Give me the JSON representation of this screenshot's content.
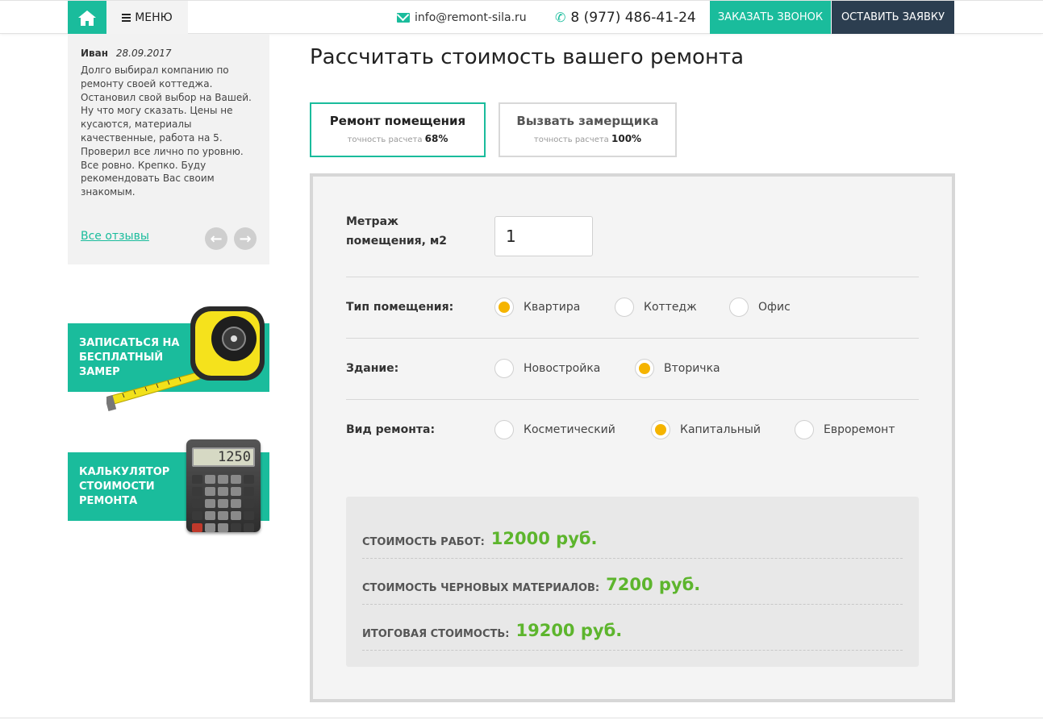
{
  "colors": {
    "accent": "#1abc9c",
    "dark": "#2c3e50",
    "price": "#5db52d",
    "radio_selected": "#f5b400"
  },
  "header": {
    "home_icon": "home-icon",
    "menu_label": "МЕНЮ",
    "email": "info@remont-sila.ru",
    "phone": "8 (977) 486-41-24",
    "call_button": "ЗАКАЗАТЬ ЗВОНОК",
    "order_button": "ОСТАВИТЬ ЗАЯВКУ"
  },
  "review": {
    "author": "Иван",
    "date": "28.09.2017",
    "text": "Долго выбирал компанию по ремонту своей коттеджа. Остановил свой выбор на Вашей. Ну что могу сказать. Цены не кусаются, материалы качественные, работа на 5. Проверил все лично по уровню. Все ровно. Крепко. Буду рекомендовать Вас своим знакомым.",
    "all_link": "Все отзывы"
  },
  "promos": {
    "measure": "Записаться на бесплатный замер",
    "calculator": "Калькулятор стоимости ремонта",
    "calculator_display": "1250"
  },
  "main": {
    "title": "Рассчитать стоимость вашего ремонта",
    "tabs": [
      {
        "title": "Ремонт помещения",
        "sub": "точность расчета",
        "accuracy": "68%",
        "active": true
      },
      {
        "title": "Вызвать замерщика",
        "sub": "точность расчета",
        "accuracy": "100%",
        "active": false
      }
    ]
  },
  "form": {
    "area_label": "Метраж помещения, м2",
    "area_value": "1",
    "room_type": {
      "label": "Тип помещения:",
      "options": [
        "Квартира",
        "Коттедж",
        "Офис"
      ],
      "selected": "Квартира"
    },
    "building": {
      "label": "Здание:",
      "options": [
        "Новостройка",
        "Вторичка"
      ],
      "selected": "Вторичка"
    },
    "repair_type": {
      "label": "Вид ремонта:",
      "options": [
        "Косметический",
        "Капитальный",
        "Евроремонт"
      ],
      "selected": "Капитальный"
    }
  },
  "results": {
    "works_label": "Стоимость работ:",
    "works_value": "12000 руб.",
    "materials_label": "Стоимость черновых материалов:",
    "materials_value": "7200 руб.",
    "total_label": "Итоговая стоимость:",
    "total_value": "19200 руб."
  }
}
